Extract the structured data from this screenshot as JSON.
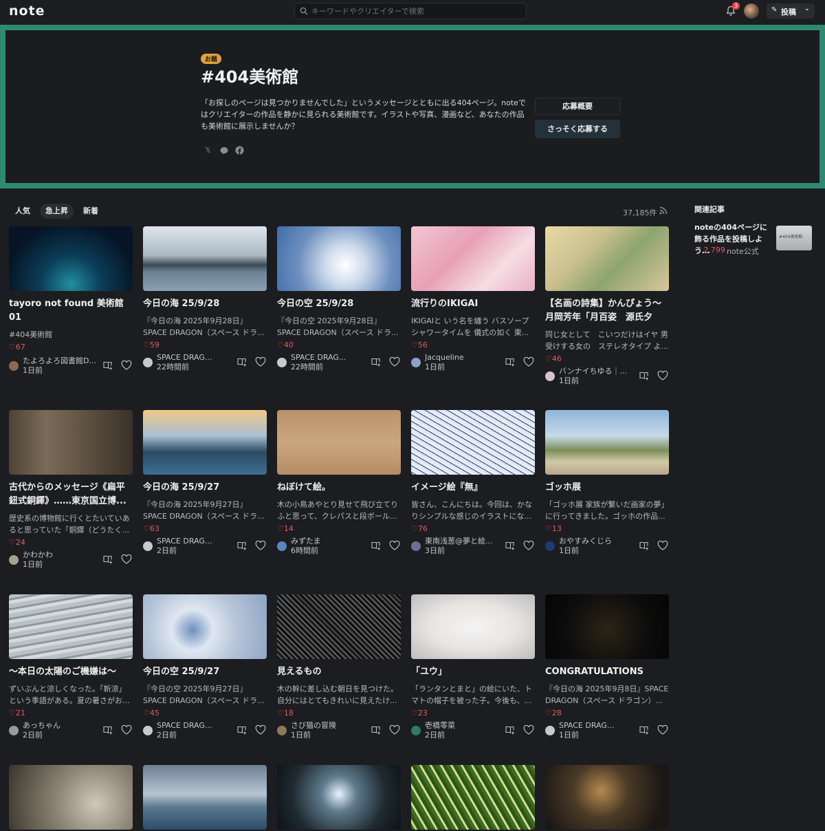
{
  "header": {
    "logo": "note",
    "search_placeholder": "キーワードやクリエイターで検索",
    "notification_count": "3",
    "post_label": "投稿"
  },
  "hero": {
    "tag": "お題",
    "title": "#404美術館",
    "description": "「お探しのページは見つかりませんでした」というメッセージとともに出る404ページ。noteではクリエイターの作品を静かに見られる美術館です。イラストや写真、漫画など、あなたの作品も美術館に展示しませんか？",
    "overview_label": "応募概要",
    "apply_label": "さっそく応募する",
    "share_icons": [
      "x-icon",
      "line-icon",
      "facebook-icon"
    ]
  },
  "tabs": [
    "人気",
    "急上昇",
    "新着"
  ],
  "active_tab": "急上昇",
  "count": "37,185件",
  "related": {
    "heading": "関連記事",
    "title": "noteの404ページに飾る作品を投稿しよう…",
    "likes": "2,799",
    "author": "note公式",
    "thumb_text": "#404美術館"
  },
  "cards": [
    {
      "title": "tayoro not found 美術館 01",
      "excerpt": "#404美術館",
      "likes": "67",
      "user": "たよろよろ図書館D...",
      "time": "1日前",
      "av": "#8b6a55"
    },
    {
      "title": "今日の海 25/9/28",
      "excerpt": "『今日の海 2025年9月28日』SPACE DRAGON（スペース ドラ...",
      "likes": "59",
      "user": "SPACE DRAG...",
      "time": "22時間前",
      "av": "#c9c9c9"
    },
    {
      "title": "今日の空 25/9/28",
      "excerpt": "『今日の空 2025年9月28日』SPACE DRAGON（スペース ドラ...",
      "likes": "40",
      "user": "SPACE DRAG...",
      "time": "22時間前",
      "av": "#c9c9c9"
    },
    {
      "title": "流行りのIKIGAI",
      "excerpt": "IKIGAIと いう名を纏う バスソープ シャワータイムを 儀式の如く 東...",
      "likes": "56",
      "user": "Jacqueline",
      "time": "1日前",
      "av": "#8ea0c8"
    },
    {
      "title": "【名画の詩集】かんぴょう〜月岡芳年「月百姿　源氏夕顔...",
      "excerpt": "同じ女として　こいつだけはイヤ 男受けする女の　ステレオタイプ よ...",
      "likes": "46",
      "user": "バンナイちゆる｜...",
      "time": "1日前",
      "av": "#d9c3c8"
    },
    {
      "title": "古代からのメッセージ《扁平鈕式銅鐸》……東京国立博...",
      "excerpt": "歴史系の博物館に行くとたいていあると思っていた「銅鐸（どうたく...",
      "likes": "24",
      "user": "かわかわ",
      "time": "1日前",
      "av": "#a7a08c"
    },
    {
      "title": "今日の海 25/9/27",
      "excerpt": "『今日の海 2025年9月27日』SPACE DRAGON（スペース ドラ...",
      "likes": "63",
      "user": "SPACE DRAG...",
      "time": "2日前",
      "av": "#c9c9c9"
    },
    {
      "title": "ねぼけて絵。",
      "excerpt": "木の小鳥あやとり見せて飛び立てりふと思って、クレパスと段ボール...",
      "likes": "14",
      "user": "みずたま",
      "time": "6時間前",
      "av": "#5a86c4"
    },
    {
      "title": "イメージ絵『無』",
      "excerpt": "皆さん、こんにちは。今回は、かなりシンプルな感じのイラストにな...",
      "likes": "76",
      "user": "東南浅葱@夢と絵...",
      "time": "3日前",
      "av": "#6b6f9a"
    },
    {
      "title": "ゴッホ展",
      "excerpt": "「ゴッホ展 家族が繋いだ画家の夢」に行ってきました。ゴッホの作品...",
      "likes": "13",
      "user": "おやすみくじら",
      "time": "1日前",
      "av": "#1e3b73"
    },
    {
      "title": "〜本日の太陽のご機嫌は〜",
      "excerpt": "ずいぶんと涼しくなった。「新涼」という季語がある。夏の暑さがお...",
      "likes": "21",
      "user": "あっちゃん",
      "time": "2日前",
      "av": "#9a9a9a"
    },
    {
      "title": "今日の空 25/9/27",
      "excerpt": "『今日の空 2025年9月27日』SPACE DRAGON（スペース ドラ...",
      "likes": "45",
      "user": "SPACE DRAG...",
      "time": "2日前",
      "av": "#c9c9c9"
    },
    {
      "title": "見えるもの",
      "excerpt": "木の幹に差し込む朝日を見つけた。自分にはとてもきれいに見えたけ...",
      "likes": "18",
      "user": "さび猫の冒険",
      "time": "1日前",
      "av": "#8c7a5c"
    },
    {
      "title": "「ユウ」",
      "excerpt": "「ランタンとまと」の絵にいた、トマトの帽子を被った子。今後も、...",
      "likes": "23",
      "user": "壱橋零菜",
      "time": "2日前",
      "av": "#2f7a66"
    },
    {
      "title": "CONGRATULATIONS",
      "excerpt": "『今日の海 2025年9月8日』SPACE DRAGON（スペース ドラゴン）...",
      "likes": "28",
      "user": "SPACE DRAG...",
      "time": "1日前",
      "av": "#c9c9c9"
    },
    {
      "title": "",
      "excerpt": "",
      "likes": "",
      "user": "",
      "time": "",
      "av": "#777"
    },
    {
      "title": "",
      "excerpt": "",
      "likes": "",
      "user": "",
      "time": "",
      "av": "#777"
    },
    {
      "title": "",
      "excerpt": "",
      "likes": "",
      "user": "",
      "time": "",
      "av": "#777"
    },
    {
      "title": "",
      "excerpt": "",
      "likes": "",
      "user": "",
      "time": "",
      "av": "#777"
    },
    {
      "title": "",
      "excerpt": "",
      "likes": "",
      "user": "",
      "time": "",
      "av": "#777"
    }
  ],
  "colors": {
    "accent": "#2d8a71",
    "like": "#e5595f",
    "tag": "#e0a33a"
  }
}
